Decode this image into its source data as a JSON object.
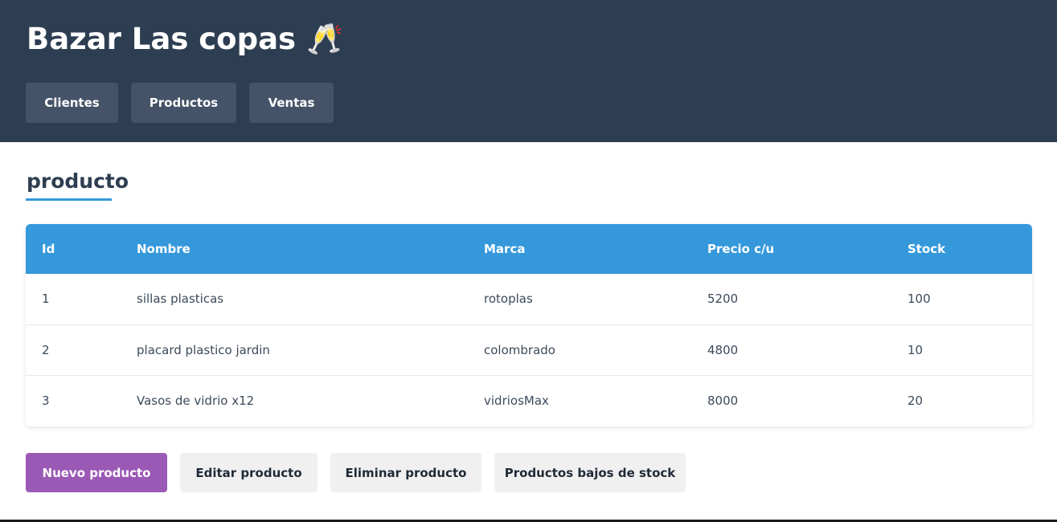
{
  "header": {
    "title": "Bazar Las copas 🥂",
    "nav": [
      "Clientes",
      "Productos",
      "Ventas"
    ]
  },
  "section": {
    "title": "producto"
  },
  "table": {
    "columns": [
      "Id",
      "Nombre",
      "Marca",
      "Precio c/u",
      "Stock"
    ],
    "rows": [
      [
        "1",
        "sillas plasticas",
        "rotoplas",
        "5200",
        "100"
      ],
      [
        "2",
        "placard plastico jardin",
        "colombrado",
        "4800",
        "10"
      ],
      [
        "3",
        "Vasos de vidrio x12",
        "vidriosMax",
        "8000",
        "20"
      ]
    ]
  },
  "actions": {
    "new": "Nuevo producto",
    "edit": "Editar producto",
    "delete": "Eliminar producto",
    "low_stock": "Productos bajos de stock"
  },
  "colors": {
    "header_bg": "#2e3e52",
    "nav_button_bg": "#445367",
    "table_header_bg": "#3598db",
    "primary_button_bg": "#9b59b6",
    "accent_underline": "#3498db"
  }
}
